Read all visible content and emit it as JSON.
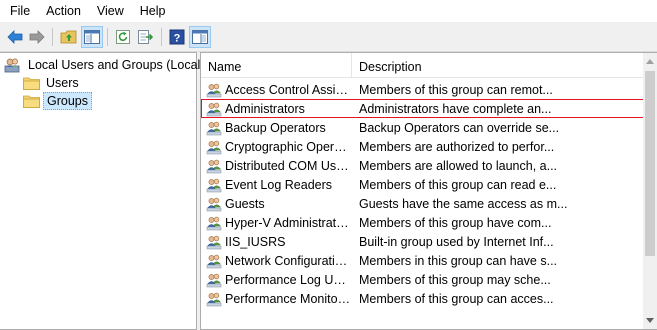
{
  "menu": [
    "File",
    "Action",
    "View",
    "Help"
  ],
  "toolbar": {
    "buttons": [
      "back-icon",
      "forward-icon",
      "up-folder-icon",
      "show-hide-tree-icon",
      "refresh-icon",
      "export-list-icon",
      "help-icon",
      "properties-pane-icon"
    ]
  },
  "tree": {
    "root": "Local Users and Groups (Local)",
    "children": [
      "Users",
      "Groups"
    ],
    "selected": "Groups"
  },
  "list": {
    "columns": [
      "Name",
      "Description"
    ],
    "rows": [
      {
        "name": "Access Control Assist...",
        "description": "Members of this group can remot..."
      },
      {
        "name": "Administrators",
        "description": "Administrators have complete an..."
      },
      {
        "name": "Backup Operators",
        "description": "Backup Operators can override se..."
      },
      {
        "name": "Cryptographic Operat...",
        "description": "Members are authorized to perfor..."
      },
      {
        "name": "Distributed COM Users",
        "description": "Members are allowed to launch, a..."
      },
      {
        "name": "Event Log Readers",
        "description": "Members of this group can read e..."
      },
      {
        "name": "Guests",
        "description": "Guests have the same access as m..."
      },
      {
        "name": "Hyper-V Administrators",
        "description": "Members of this group have com..."
      },
      {
        "name": "IIS_IUSRS",
        "description": "Built-in group used by Internet Inf..."
      },
      {
        "name": "Network Configuratio...",
        "description": "Members in this group can have s..."
      },
      {
        "name": "Performance Log Users",
        "description": "Members of this group may sche..."
      },
      {
        "name": "Performance Monitor ...",
        "description": "Members of this group can acces..."
      }
    ],
    "highlighted_row": "Administrators"
  },
  "colors": {
    "highlight_outline": "#e81123",
    "selection": "#cce8ff",
    "folder": "#f5d26b"
  }
}
